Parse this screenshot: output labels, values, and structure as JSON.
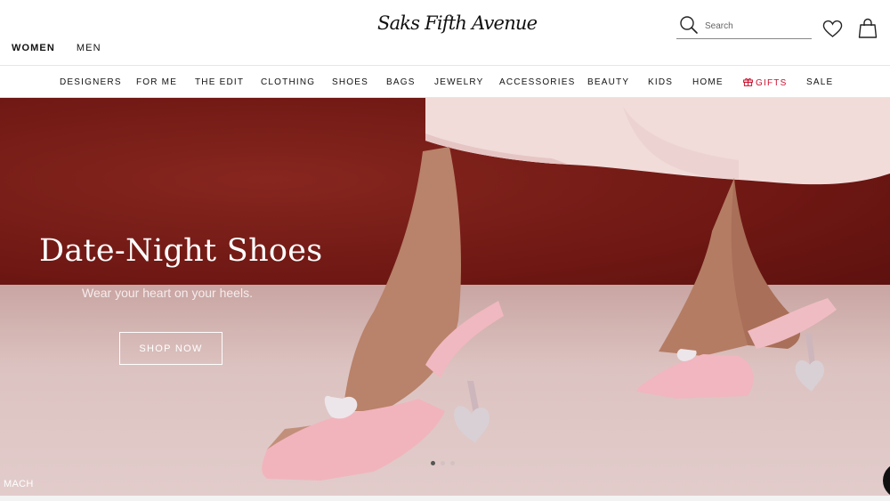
{
  "header": {
    "logo_text": "Saks Fifth Avenue",
    "gender_tabs": [
      {
        "label": "WOMEN",
        "active": true
      },
      {
        "label": "MEN",
        "active": false
      }
    ],
    "search": {
      "placeholder": "Search",
      "value": ""
    },
    "icons": [
      "search-icon",
      "heart-icon",
      "bag-icon"
    ]
  },
  "nav": {
    "items": [
      {
        "label": "DESIGNERS"
      },
      {
        "label": "FOR ME"
      },
      {
        "label": "THE EDIT"
      },
      {
        "label": "CLOTHING"
      },
      {
        "label": "SHOES"
      },
      {
        "label": "BAGS"
      },
      {
        "label": "JEWELRY"
      },
      {
        "label": "ACCESSORIES"
      },
      {
        "label": "BEAUTY"
      },
      {
        "label": "KIDS"
      },
      {
        "label": "HOME"
      },
      {
        "label": "GIFTS",
        "icon": "gift-icon",
        "color": "#c8102e"
      },
      {
        "label": "SALE"
      }
    ]
  },
  "hero": {
    "title": "Date-Night Shoes",
    "subtitle": "Wear your heart on your heels.",
    "cta_label": "SHOP NOW",
    "credit": "MACH",
    "carousel": {
      "slides": 3,
      "active_index": 0
    }
  },
  "colors": {
    "accent_gifts": "#c8102e",
    "hero_wall": "#7a1c18",
    "hero_floor": "#dcc3c1",
    "shoe_pink": "#f2b8c0"
  }
}
